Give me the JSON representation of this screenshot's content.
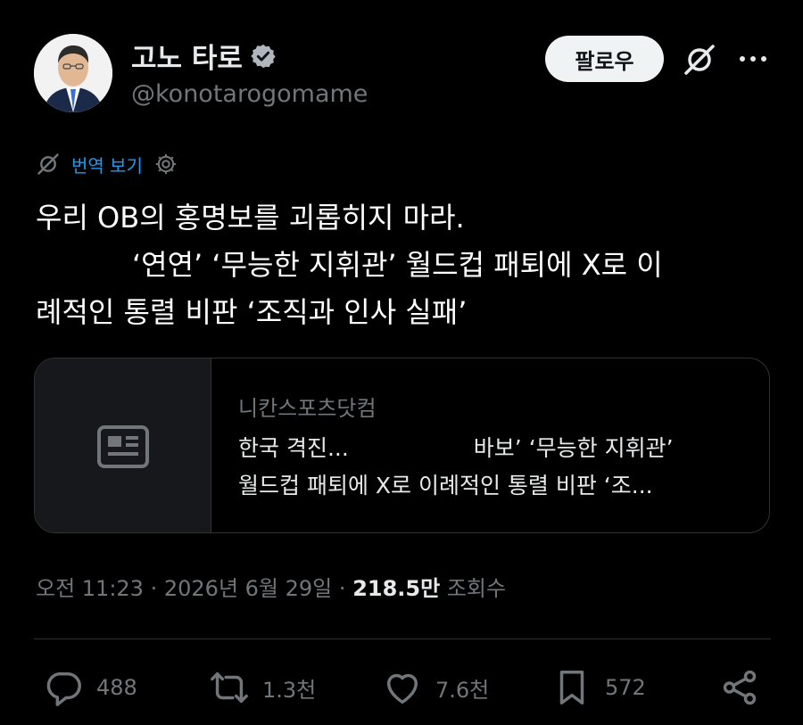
{
  "author": {
    "display_name": "고노 타로",
    "handle": "@konotarogomame",
    "verified_icon": "verified-badge-icon",
    "avatar_icon": "avatar-portrait"
  },
  "header": {
    "follow_label": "팔로우",
    "grok_icon": "grok-icon",
    "more_icon": "more-icon"
  },
  "translate": {
    "label": "번역 보기",
    "icon": "grok-icon",
    "settings_icon": "gear-icon"
  },
  "tweet": {
    "line1": "우리 OB의 홍명보를 괴롭히지 마라.",
    "line2": "‘연연’ ‘무능한 지휘관’ 월드컵 패퇴에 X로 이",
    "line3": "례적인 통렬 비판 ‘조직과 인사 실패’"
  },
  "card": {
    "thumb_icon": "newspaper-icon",
    "domain": "니칸스포츠닷컴",
    "title_line1_a": "한국 격진...",
    "title_line1_b": "바보’ ‘무능한 지휘관’",
    "title_line2": "월드컵 패퇴에 X로 이례적인 통렬 비판 ‘조..."
  },
  "meta": {
    "time": "오전 11:23",
    "date": "2026년 6월 29일",
    "views_count": "218.5만",
    "views_label": "조회수",
    "separator": "·"
  },
  "actions": {
    "replies": "488",
    "reposts": "1.3천",
    "likes": "7.6천",
    "bookmarks": "572"
  },
  "colors": {
    "background": "#000000",
    "text": "#e7e9ea",
    "secondary": "#71767b",
    "accent": "#1d9bf0",
    "border": "#2f3336"
  }
}
